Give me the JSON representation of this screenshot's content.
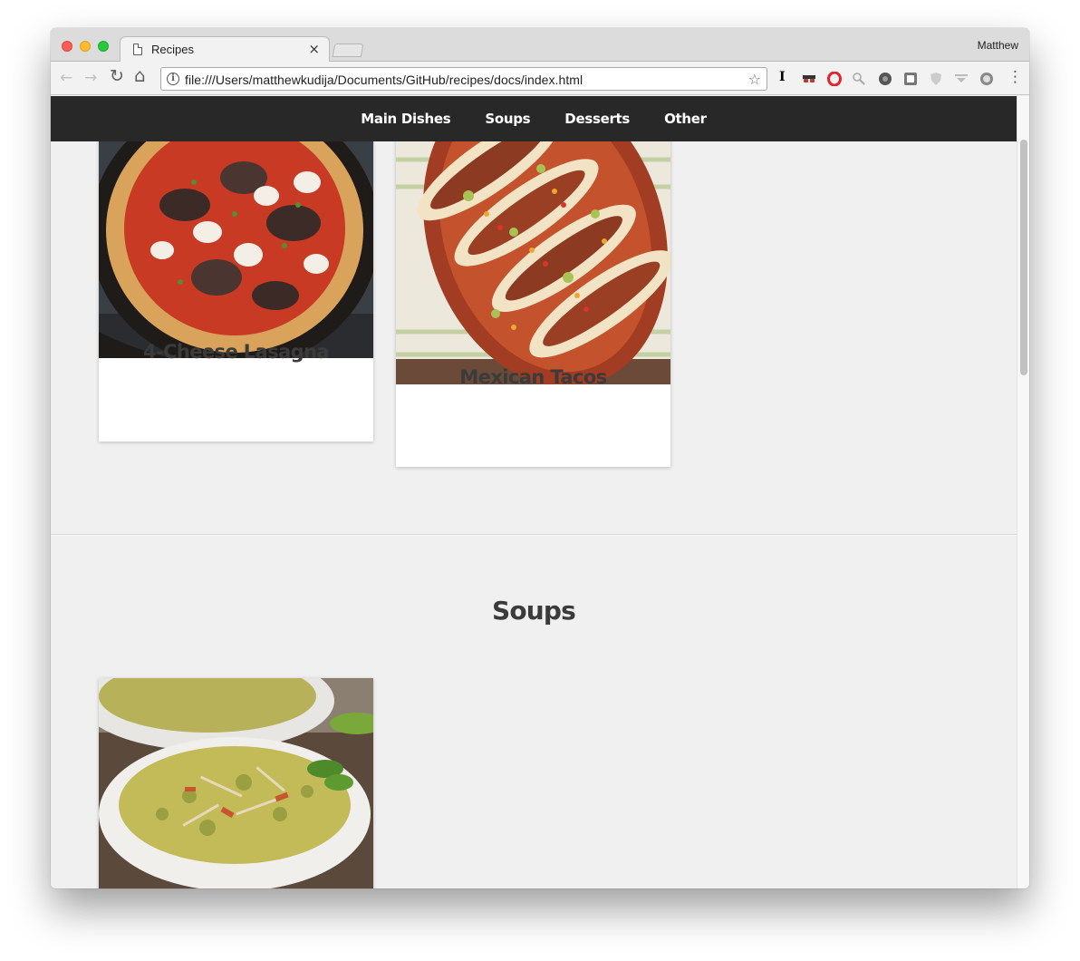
{
  "browser": {
    "tab_title": "Recipes",
    "tab_close": "×",
    "profile_name": "Matthew",
    "url": "file:///Users/matthewkudija/Documents/GitHub/recipes/docs/index.html",
    "back_icon": "←",
    "forward_icon": "→",
    "reload_icon": "↻",
    "home_icon": "⌂",
    "info_icon": "i",
    "star_icon": "☆",
    "menu_icon": "⋮",
    "extensions": [
      "instapaper-icon",
      "incognito-icon",
      "opera-icon",
      "search-extension-icon",
      "extension-icon",
      "save-extension-icon",
      "shield-icon",
      "dropdown-extension-icon",
      "github-icon"
    ]
  },
  "site_nav": {
    "items": [
      "Main Dishes",
      "Soups",
      "Desserts",
      "Other"
    ]
  },
  "main_dishes": {
    "cards": [
      {
        "title": "4-Cheese Lasagna"
      },
      {
        "title": "Mexican Tacos"
      }
    ]
  },
  "soups": {
    "heading": "Soups"
  },
  "colors": {
    "nav_bg": "#282828",
    "page_bg": "#f0f0f0",
    "title_text": "#3b3b3b"
  }
}
